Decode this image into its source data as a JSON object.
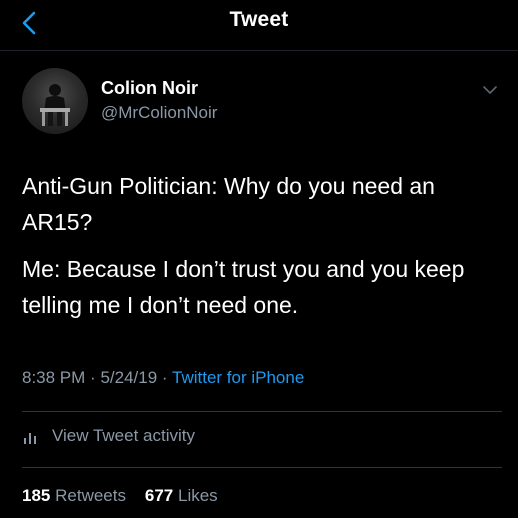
{
  "header": {
    "title": "Tweet",
    "back_icon": "chevron-left-icon",
    "accent": "#1d9bf0"
  },
  "author": {
    "name": "Colion Noir",
    "handle": "@MrColionNoir",
    "menu_icon": "chevron-down-icon"
  },
  "tweet": {
    "paragraphs": [
      "Anti-Gun Politician: Why do you need an AR15?",
      "Me:  Because I don’t trust you and you keep telling me I don’t need one."
    ],
    "time": "8:38 PM",
    "date": "5/24/19",
    "separator": "·",
    "source": "Twitter for iPhone"
  },
  "activity": {
    "label": "View Tweet activity",
    "icon": "bar-chart-icon"
  },
  "stats": {
    "retweets_count": "185",
    "retweets_label": "Retweets",
    "likes_count": "677",
    "likes_label": "Likes"
  },
  "colors": {
    "background": "#000000",
    "text": "#ffffff",
    "secondary": "#8b98a5",
    "link": "#1d9bf0"
  }
}
